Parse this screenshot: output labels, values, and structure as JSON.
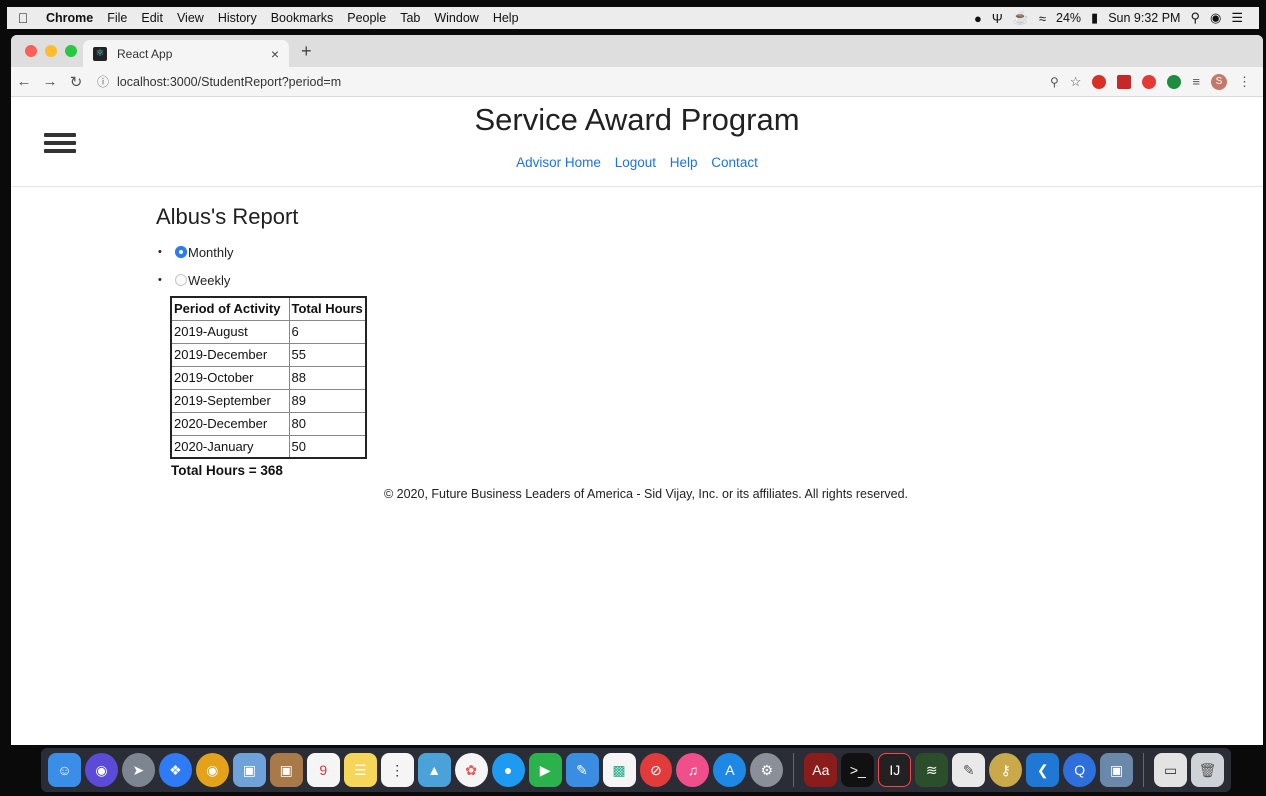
{
  "menubar": {
    "items": [
      "Chrome",
      "File",
      "Edit",
      "View",
      "History",
      "Bookmarks",
      "People",
      "Tab",
      "Window",
      "Help"
    ],
    "battery": "24%",
    "clock": "Sun 9:32 PM"
  },
  "browser": {
    "tab_title": "React App",
    "url": "localhost:3000/StudentReport?period=m",
    "profile_initial": "S"
  },
  "page": {
    "title": "Service Award Program",
    "nav": [
      "Advisor Home",
      "Logout",
      "Help",
      "Contact"
    ],
    "report_title": "Albus's Report",
    "period_options": [
      {
        "label": "Monthly",
        "selected": true
      },
      {
        "label": "Weekly",
        "selected": false
      }
    ],
    "table": {
      "headers": [
        "Period of Activity",
        "Total Hours"
      ],
      "rows": [
        [
          "2019-August",
          "6"
        ],
        [
          "2019-December",
          "55"
        ],
        [
          "2019-October",
          "88"
        ],
        [
          "2019-September",
          "89"
        ],
        [
          "2020-December",
          "80"
        ],
        [
          "2020-January",
          "50"
        ]
      ]
    },
    "total": "Total Hours = 368",
    "footer": "© 2020, Future Business Leaders of America - Sid Vijay, Inc. or its affiliates. All rights reserved."
  },
  "colors": {
    "link": "#1a73e8",
    "radio_selected": "#2d7cf6"
  }
}
